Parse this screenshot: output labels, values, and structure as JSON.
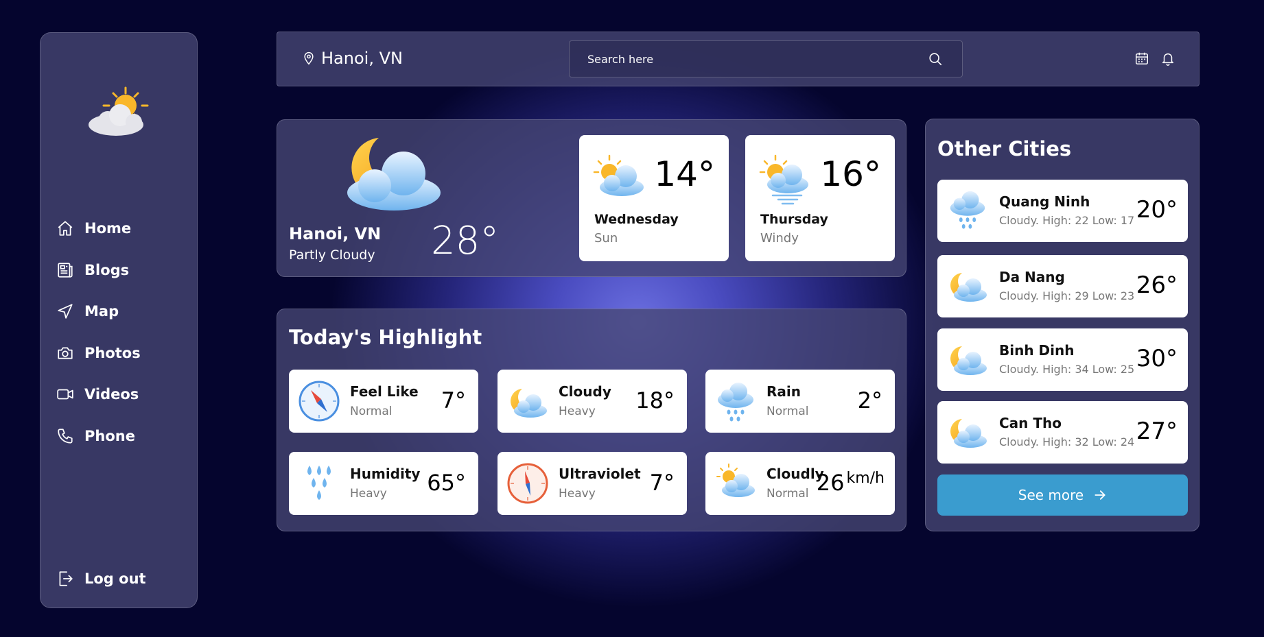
{
  "sidebar": {
    "items": [
      {
        "label": "Home",
        "icon": "home-icon"
      },
      {
        "label": "Blogs",
        "icon": "newspaper-icon"
      },
      {
        "label": "Map",
        "icon": "navigation-icon"
      },
      {
        "label": "Photos",
        "icon": "camera-icon"
      },
      {
        "label": "Videos",
        "icon": "video-icon"
      },
      {
        "label": "Phone",
        "icon": "phone-icon"
      }
    ],
    "logout_label": "Log out"
  },
  "header": {
    "location": "Hanoi, VN",
    "search_placeholder": "Search here"
  },
  "current": {
    "city": "Hanoi, VN",
    "condition": "Partly Cloudy",
    "temp": "28°"
  },
  "forecast": [
    {
      "day": "Wednesday",
      "sub": "Sun",
      "temp": "14°",
      "icon": "sun-cloud-icon"
    },
    {
      "day": "Thursday",
      "sub": "Windy",
      "temp": "16°",
      "icon": "sun-cloud-wind-icon"
    }
  ],
  "highlight": {
    "title": "Today's Highlight",
    "cards": [
      {
        "name": "Feel Like",
        "sub": "Normal",
        "value": "7°",
        "unit": "",
        "icon": "compass-icon"
      },
      {
        "name": "Cloudy",
        "sub": "Heavy",
        "value": "18°",
        "unit": "",
        "icon": "moon-cloud-icon"
      },
      {
        "name": "Rain",
        "sub": "Normal",
        "value": "2°",
        "unit": "",
        "icon": "rain-cloud-icon"
      },
      {
        "name": "Humidity",
        "sub": "Heavy",
        "value": "65°",
        "unit": "",
        "icon": "raindrops-icon"
      },
      {
        "name": "Ultraviolet",
        "sub": "Heavy",
        "value": "7°",
        "unit": "",
        "icon": "compass-red-icon"
      },
      {
        "name": "Cloudly",
        "sub": "Normal",
        "value": "26",
        "unit": "km/h",
        "icon": "sun-cloud-icon"
      }
    ]
  },
  "cities": {
    "title": "Other Cities",
    "items": [
      {
        "name": "Quang Ninh",
        "sub": "Cloudy. High: 22 Low: 17",
        "temp": "20°",
        "icon": "rain-cloud-icon"
      },
      {
        "name": "Da Nang",
        "sub": "Cloudy. High: 29 Low: 23",
        "temp": "26°",
        "icon": "moon-cloud-icon"
      },
      {
        "name": "Binh Dinh",
        "sub": "Cloudy. High: 34 Low: 25",
        "temp": "30°",
        "icon": "moon-cloud-icon"
      },
      {
        "name": "Can Tho",
        "sub": "Cloudy. High: 32 Low: 24",
        "temp": "27°",
        "icon": "moon-cloud-icon"
      }
    ],
    "see_more": "See more"
  },
  "colors": {
    "background": "#05052e",
    "panel": "#46467380",
    "accent_button": "#3a9ccf",
    "sun": "#f9b72a",
    "cloud": "#8ccaf5"
  }
}
